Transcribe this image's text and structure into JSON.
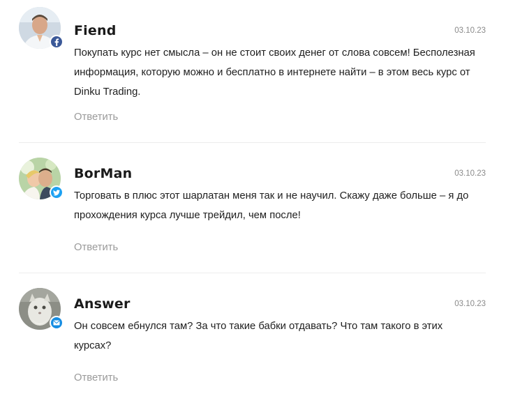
{
  "comments": [
    {
      "author": "Fiend",
      "date": "03.10.23",
      "text": "Покупать курс нет смысла – он не стоит своих денег от слова совсем! Бесполезная информация, которую можно и бесплатно в интернете найти – в этом весь курс от Dinku Trading.",
      "reply_label": "Ответить",
      "social_icon": "facebook-icon",
      "badge_color": "#3b5998"
    },
    {
      "author": "BorMan",
      "date": "03.10.23",
      "text": "Торговать в плюс этот шарлатан меня так и не научил. Скажу даже больше – я до прохождения курса лучше трейдил, чем после!",
      "reply_label": "Ответить",
      "social_icon": "twitter-icon",
      "badge_color": "#1da1f2"
    },
    {
      "author": "Answer",
      "date": "03.10.23",
      "text": "Он совсем ебнулся там? За что такие бабки отдавать? Что там такого в этих курсах?",
      "reply_label": "Ответить",
      "social_icon": "mail-icon",
      "badge_color": "#168de2"
    }
  ]
}
